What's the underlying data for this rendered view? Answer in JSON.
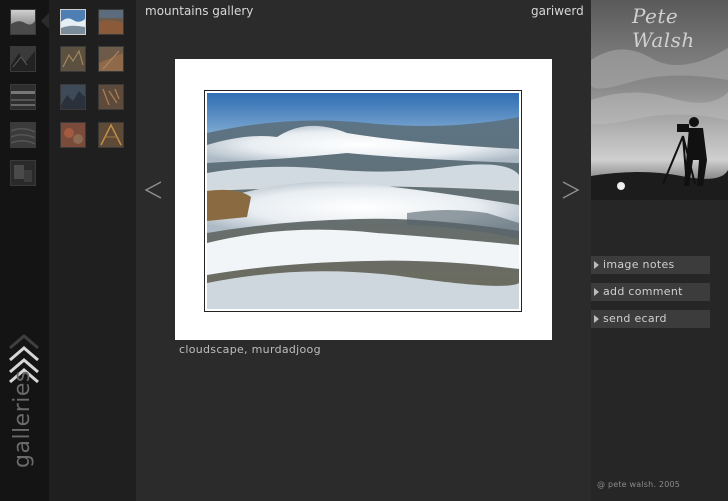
{
  "left": {
    "label": "galleries",
    "gallery_thumbs": [
      {
        "name": "gallery-thumb-1",
        "icon": "gallery-thumbnail-image"
      },
      {
        "name": "gallery-thumb-2",
        "icon": "gallery-thumbnail-image"
      },
      {
        "name": "gallery-thumb-3",
        "icon": "gallery-thumbnail-image"
      },
      {
        "name": "gallery-thumb-4",
        "icon": "gallery-thumbnail-image"
      },
      {
        "name": "gallery-thumb-5",
        "icon": "gallery-thumbnail-image"
      }
    ]
  },
  "thumbs": {
    "count": 8,
    "active_index": 0
  },
  "main": {
    "gallery_title": "mountains gallery",
    "gallery_name": "gariwerd",
    "caption": "cloudscape, murdadjoog",
    "prev_icon": "chevron-left-icon",
    "next_icon": "chevron-right-icon"
  },
  "right": {
    "brand": "Pete Walsh",
    "menu": [
      {
        "label": "image notes"
      },
      {
        "label": "add comment"
      },
      {
        "label": "send ecard"
      }
    ],
    "copyright": "@ pete walsh. 2005"
  },
  "colors": {
    "background": "#2b2b2b",
    "left_strip": "#141414",
    "thumb_column": "#1f1f1f",
    "menu_button": "#3c3c3c",
    "text_light": "#d8d8d8"
  }
}
